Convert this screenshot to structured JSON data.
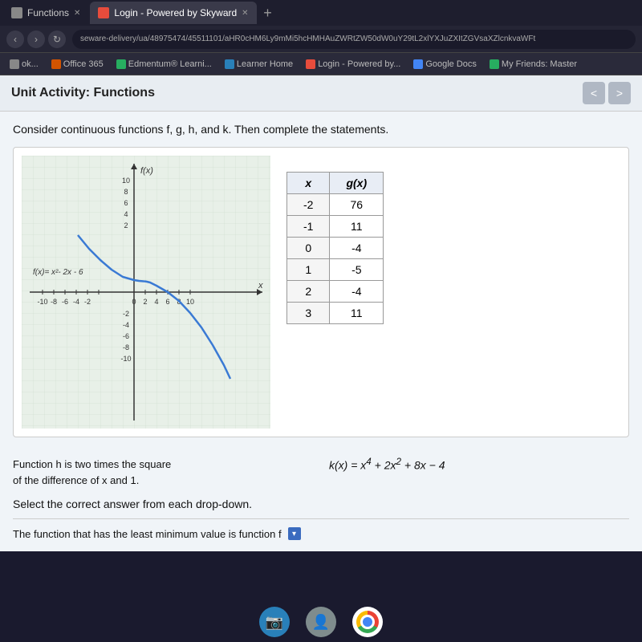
{
  "browser": {
    "tabs": [
      {
        "id": "tab1",
        "label": "Functions",
        "active": false,
        "icon": "page"
      },
      {
        "id": "tab2",
        "label": "Login - Powered by Skyward",
        "active": true,
        "icon": "skyward"
      },
      {
        "id": "tab3",
        "label": "+",
        "active": false,
        "icon": "new"
      }
    ],
    "url": "seware-delivery/ua/48975474/45511101/aHR0cHM6Ly9mMi5hcHMHAuZWRtZW50dW0uY29tL2xlYXJuZXItZGVsaXZlcnkvaWFt",
    "bookmarks": [
      {
        "label": "ok...",
        "icon": "plain"
      },
      {
        "label": "Office 365",
        "icon": "office"
      },
      {
        "label": "Edmentum® Learni...",
        "icon": "edmentum"
      },
      {
        "label": "Learner Home",
        "icon": "learner"
      },
      {
        "label": "Login - Powered by...",
        "icon": "skyward"
      },
      {
        "label": "Google Docs",
        "icon": "gdocs"
      },
      {
        "label": "My Friends: Master",
        "icon": "myf"
      }
    ]
  },
  "page": {
    "title": "Unit Activity: Functions",
    "instruction": "Consider continuous functions f, g, h, and k. Then complete the statements.",
    "graph": {
      "label_y": "f(x)",
      "label_x": "x",
      "equation": "f(x)= x²- 2x - 6",
      "x_ticks": [
        "-10",
        "-8",
        "-6",
        "-4",
        "-2",
        "0",
        "2",
        "4",
        "6",
        "8",
        "10"
      ],
      "y_ticks": [
        "-10",
        "-8",
        "-6",
        "-4",
        "-2",
        "0",
        "2",
        "4",
        "6",
        "8",
        "10"
      ]
    },
    "g_table": {
      "col1_header": "x",
      "col2_header": "g(x)",
      "rows": [
        {
          "x": "-2",
          "gx": "76"
        },
        {
          "x": "-1",
          "gx": "11"
        },
        {
          "x": "0",
          "gx": "-4"
        },
        {
          "x": "1",
          "gx": "-5"
        },
        {
          "x": "2",
          "gx": "-4"
        },
        {
          "x": "3",
          "gx": "11"
        }
      ]
    },
    "h_description": "Function h is two times the square\nof the difference of x and 1.",
    "k_function": "k(x) = x⁴ + 2x² + 8x − 4",
    "select_text": "Select the correct answer from each drop-down.",
    "bottom_text": "The function that has the least minimum value is function  f",
    "nav_back": "<",
    "nav_forward": ">"
  },
  "taskbar": {
    "video_icon": "📷",
    "person_icon": "👤"
  }
}
